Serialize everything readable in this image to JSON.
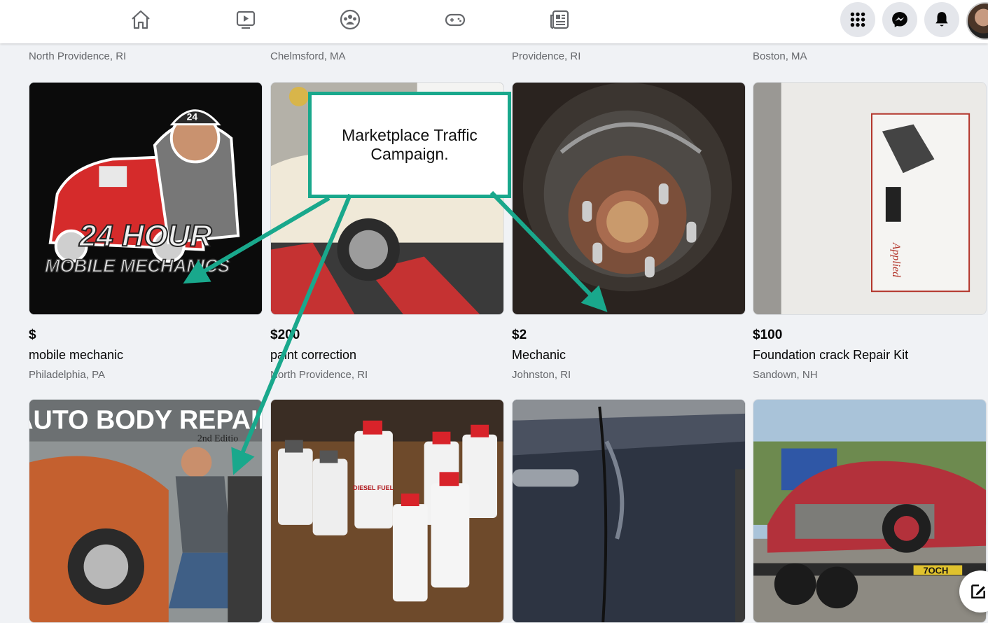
{
  "nav": {
    "icons": [
      "home-icon",
      "watch-icon",
      "groups-icon",
      "gaming-icon",
      "news-feed-icon"
    ],
    "right_buttons": [
      "menu-grid-icon",
      "messenger-icon",
      "notifications-icon",
      "avatar"
    ]
  },
  "top_row": [
    {
      "location": "North Providence, RI"
    },
    {
      "location": "Chelmsford, MA"
    },
    {
      "location": "Providence, RI"
    },
    {
      "location": "Boston, MA"
    }
  ],
  "listings": [
    {
      "price": "$",
      "title": "mobile mechanic",
      "location": "Philadelphia, PA",
      "image_text_1": "24 HOUR",
      "image_text_2": "MOBILE MECHANICS",
      "image_badge": "24"
    },
    {
      "price": "$200",
      "title": "paint correction",
      "location": "North Providence, RI"
    },
    {
      "price": "$2",
      "title": "Mechanic",
      "location": "Johnston, RI"
    },
    {
      "price": "$100",
      "title": "Foundation crack Repair Kit",
      "location": "Sandown, NH",
      "image_text_1": "Applied"
    }
  ],
  "bottom_row": [
    {
      "image_text_1": "AUTO BODY REPAIR",
      "image_text_2": "2nd Editio"
    },
    {
      "image_text_1": "DIESEL FUEL"
    },
    {},
    {
      "image_text_1": "7OCH"
    }
  ],
  "callout": {
    "text": "Marketplace Traffic Campaign."
  },
  "colors": {
    "accent": "#19a88c",
    "page_bg": "#f0f2f5",
    "text_secondary": "#65676b"
  }
}
